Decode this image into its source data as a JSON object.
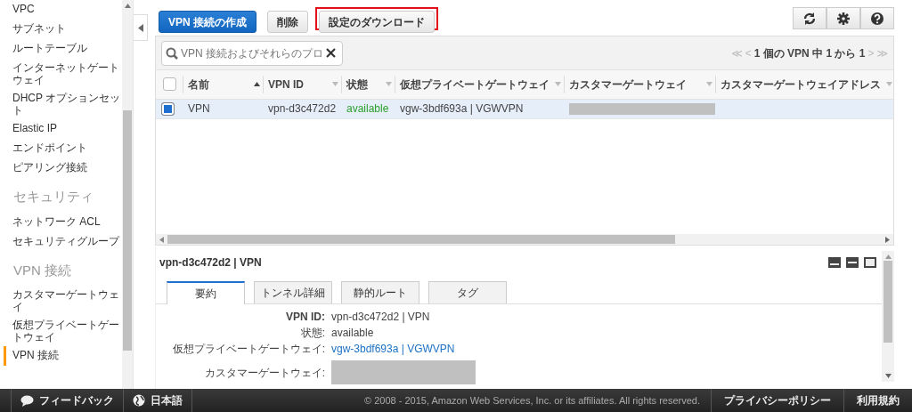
{
  "sidebar": {
    "items": [
      {
        "kind": "item",
        "label": "VPC",
        "selected": false
      },
      {
        "kind": "item",
        "label": "サブネット",
        "selected": false
      },
      {
        "kind": "item",
        "label": "ルートテーブル",
        "selected": false
      },
      {
        "kind": "item",
        "label": "インターネットゲートウェイ",
        "selected": false
      },
      {
        "kind": "item",
        "label": "DHCP オプションセット",
        "selected": false
      },
      {
        "kind": "item",
        "label": "Elastic IP",
        "selected": false
      },
      {
        "kind": "item",
        "label": "エンドポイント",
        "selected": false
      },
      {
        "kind": "item",
        "label": "ピアリング接続",
        "selected": false
      },
      {
        "kind": "heading",
        "label": "セキュリティ"
      },
      {
        "kind": "item",
        "label": "ネットワーク ACL",
        "selected": false
      },
      {
        "kind": "item",
        "label": "セキュリティグループ",
        "selected": false
      },
      {
        "kind": "heading",
        "label": "VPN 接続"
      },
      {
        "kind": "item",
        "label": "カスタマーゲートウェイ",
        "selected": false
      },
      {
        "kind": "item",
        "label": "仮想プライベートゲートウェイ",
        "selected": false
      },
      {
        "kind": "item",
        "label": "VPN 接続",
        "selected": true
      }
    ]
  },
  "toolbar": {
    "buttons": [
      {
        "kind": "primary",
        "label": "VPN 接続の作成",
        "highlighted": false
      },
      {
        "kind": "default",
        "label": "削除",
        "highlighted": false
      },
      {
        "kind": "default",
        "label": "設定のダウンロード",
        "highlighted": true
      }
    ]
  },
  "search": {
    "placeholder": "VPN 接続およびそれらのプロ"
  },
  "pagination": {
    "first": "≪",
    "prev": "<",
    "text": "1 個の VPN 中 1 から 1",
    "next": ">",
    "last": "≫",
    "disabled": true
  },
  "table": {
    "all_selected": false,
    "columns": [
      {
        "label": "名前",
        "sorted": true
      },
      {
        "label": "VPN ID",
        "sorted": false
      },
      {
        "label": "状態",
        "sorted": false
      },
      {
        "label": "仮想プライベートゲートウェイ",
        "sorted": false
      },
      {
        "label": "カスタマーゲートウェイ",
        "sorted": false
      },
      {
        "label": "カスタマーゲートウェイアドレス",
        "sorted": false
      }
    ],
    "rows": [
      {
        "selected": true,
        "cells": [
          {
            "kind": "text",
            "text": "VPN"
          },
          {
            "kind": "text",
            "text": "vpn-d3c472d2"
          },
          {
            "kind": "status",
            "text": "available"
          },
          {
            "kind": "text",
            "text": "vgw-3bdf693a | VGWVPN"
          },
          {
            "kind": "redacted"
          },
          {
            "kind": "empty"
          }
        ]
      }
    ]
  },
  "detail": {
    "title": "vpn-d3c472d2 | VPN",
    "tabs": [
      {
        "label": "要約",
        "selected": true
      },
      {
        "label": "トンネル詳細",
        "selected": false
      },
      {
        "label": "静的ルート",
        "selected": false
      },
      {
        "label": "タグ",
        "selected": false
      }
    ],
    "fields": [
      {
        "kind": "text",
        "label": "VPN ID:",
        "value": "vpn-d3c472d2 | VPN"
      },
      {
        "kind": "text",
        "label": "状態:",
        "value": "available"
      },
      {
        "kind": "link",
        "label": "仮想プライベートゲートウェイ:",
        "value": "vgw-3bdf693a | VGWVPN"
      },
      {
        "kind": "redacted",
        "label": "カスタマーゲートウェイ:"
      }
    ]
  },
  "footer": {
    "feedback": "フィードバック",
    "language": "日本語",
    "copyright": "© 2008 - 2015, Amazon Web Services, Inc. or its affiliates. All rights reserved.",
    "links": [
      "プライバシーポリシー",
      "利用規約"
    ]
  }
}
